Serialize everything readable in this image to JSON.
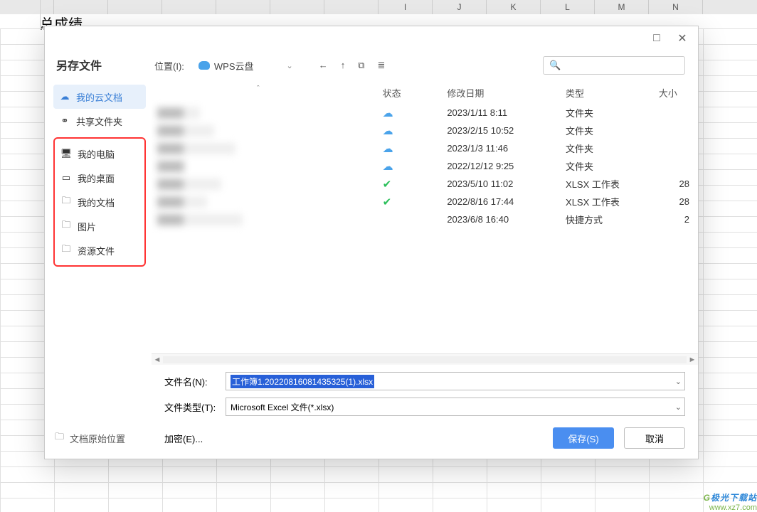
{
  "sheet": {
    "big_text": "总成绩",
    "columns": [
      "",
      "",
      "",
      "",
      "",
      "",
      "",
      "I",
      "J",
      "K",
      "L",
      "M",
      "N"
    ]
  },
  "dialog": {
    "title": "另存文件",
    "sidebar": {
      "items": [
        {
          "icon": "cloud",
          "label": "我的云文档",
          "active": true
        },
        {
          "icon": "share",
          "label": "共享文件夹"
        }
      ],
      "redbox": [
        {
          "icon": "monitor",
          "label": "我的电脑"
        },
        {
          "icon": "desktop",
          "label": "我的桌面"
        },
        {
          "icon": "folder",
          "label": "我的文档"
        },
        {
          "icon": "folder",
          "label": "图片"
        },
        {
          "icon": "folder",
          "label": "资源文件"
        }
      ]
    },
    "original_location": "文档原始位置",
    "toolbar": {
      "location_label": "位置(I):",
      "location_value": "WPS云盘",
      "search_placeholder": ""
    },
    "filelist": {
      "headers": {
        "name": "",
        "status": "状态",
        "date": "修改日期",
        "type": "类型",
        "size": "大小"
      },
      "rows": [
        {
          "status": "cloud",
          "date": "2023/1/11 8:11",
          "type": "文件夹",
          "size": ""
        },
        {
          "status": "cloud",
          "date": "2023/2/15 10:52",
          "type": "文件夹",
          "size": ""
        },
        {
          "status": "cloud",
          "date": "2023/1/3 11:46",
          "type": "文件夹",
          "size": ""
        },
        {
          "status": "cloud",
          "date": "2022/12/12 9:25",
          "type": "文件夹",
          "size": ""
        },
        {
          "status": "check",
          "date": "2023/5/10 11:02",
          "type": "XLSX 工作表",
          "size": "28"
        },
        {
          "status": "check",
          "date": "2022/8/16 17:44",
          "type": "XLSX 工作表",
          "size": "28"
        },
        {
          "status": "",
          "date": "2023/6/8 16:40",
          "type": "快捷方式",
          "size": "2"
        }
      ]
    },
    "form": {
      "filename_label": "文件名(N):",
      "filename_value": "工作簿1.20220816081435325(1).xlsx",
      "filetype_label": "文件类型(T):",
      "filetype_value": "Microsoft Excel 文件(*.xlsx)",
      "encrypt_label": "加密(E)"
    },
    "buttons": {
      "save": "保存(S)",
      "cancel": "取消"
    }
  },
  "watermark": {
    "t1": "极光下载站",
    "t2": "www.xz7.com"
  },
  "icons": {
    "cloud": "☁",
    "share": "⚭",
    "monitor": "🖥",
    "desktop": "▭",
    "folder": "🗀",
    "back": "←",
    "up": "↑",
    "newf": "⧉",
    "view": "≣",
    "search": "🔍",
    "maximize": "□",
    "close": "✕",
    "chevron": "⌄",
    "caret": "ˆ"
  }
}
